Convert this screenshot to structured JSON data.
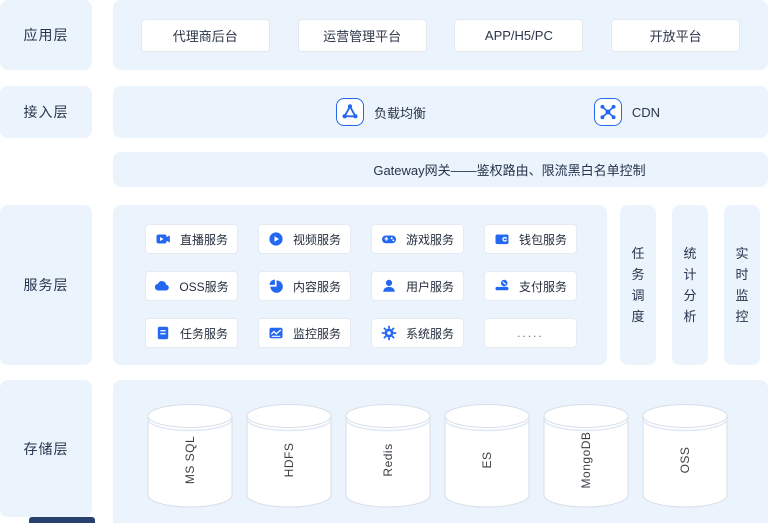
{
  "accent_color": "#2468f2",
  "panel_color": "#ebf3fd",
  "layers": {
    "app": {
      "label": "应用层",
      "items": [
        "代理商后台",
        "运营管理平台",
        "APP/H5/PC",
        "开放平台"
      ]
    },
    "access": {
      "label": "接入层",
      "items": [
        {
          "icon": "load-balancer-icon",
          "label": "负载均衡"
        },
        {
          "icon": "cdn-icon",
          "label": "CDN"
        }
      ]
    },
    "gateway": {
      "text": "Gateway网关——鉴权路由、限流黑白名单控制"
    },
    "service": {
      "label": "服务层",
      "cards": [
        {
          "icon": "live-icon",
          "label": "直播服务"
        },
        {
          "icon": "video-icon",
          "label": "视频服务"
        },
        {
          "icon": "game-icon",
          "label": "游戏服务"
        },
        {
          "icon": "wallet-icon",
          "label": "钱包服务"
        },
        {
          "icon": "oss-icon",
          "label": "OSS服务"
        },
        {
          "icon": "content-icon",
          "label": "内容服务"
        },
        {
          "icon": "user-icon",
          "label": "用户服务"
        },
        {
          "icon": "pay-icon",
          "label": "支付服务"
        },
        {
          "icon": "task-icon",
          "label": "任务服务"
        },
        {
          "icon": "monitor-icon",
          "label": "监控服务"
        },
        {
          "icon": "system-icon",
          "label": "系统服务"
        },
        {
          "icon": "",
          "label": "....."
        }
      ],
      "side_columns": [
        "任务调度",
        "统计分析",
        "实时监控"
      ]
    },
    "storage": {
      "label": "存储层",
      "databases": [
        "MS SQL",
        "HDFS",
        "Redis",
        "ES",
        "MongoDB",
        "OSS"
      ]
    }
  }
}
